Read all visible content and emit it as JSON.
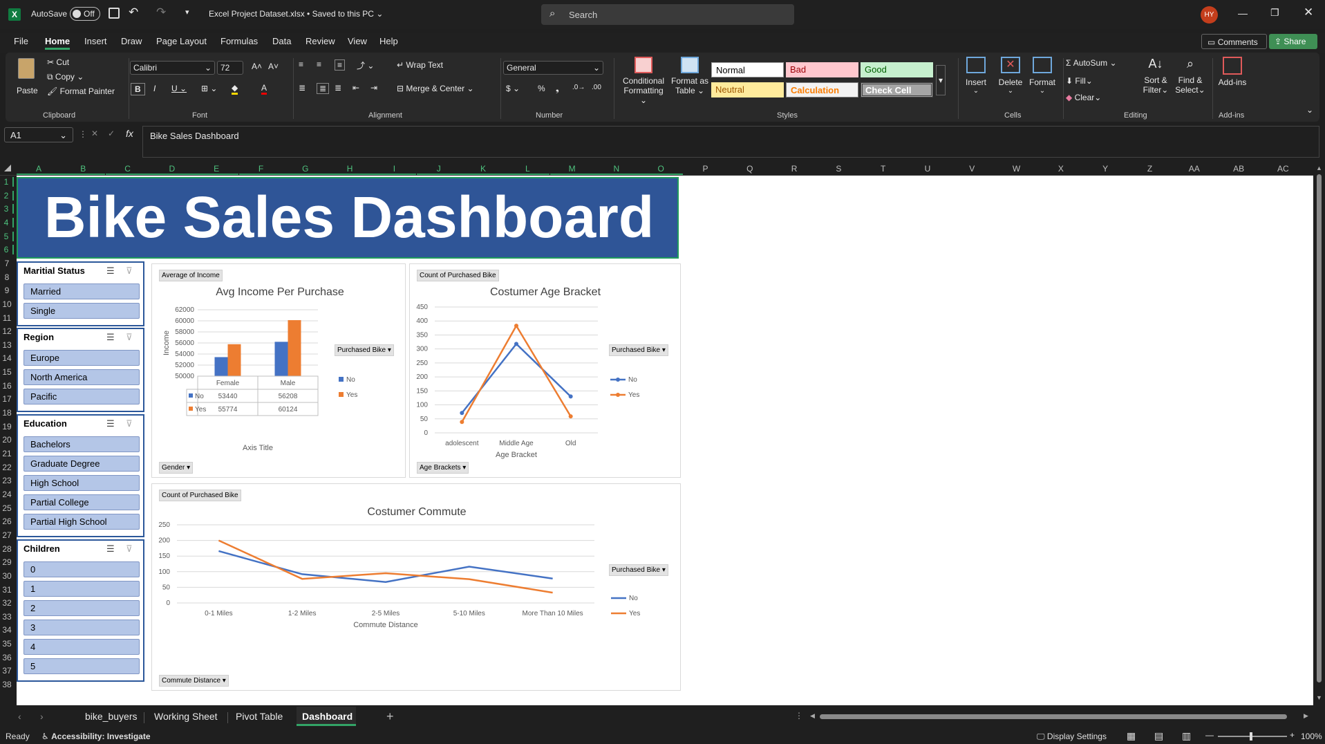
{
  "titlebar": {
    "autosave_label": "AutoSave",
    "autosave_state": "Off",
    "file_title": "Excel Project Dataset.xlsx",
    "saved_status": "Saved to this PC",
    "search_placeholder": "Search",
    "user_initials": "HY"
  },
  "menu": {
    "tabs": [
      "File",
      "Home",
      "Insert",
      "Draw",
      "Page Layout",
      "Formulas",
      "Data",
      "Review",
      "View",
      "Help"
    ],
    "comments": "Comments",
    "share": "Share"
  },
  "ribbon": {
    "paste": "Paste",
    "cut": "Cut",
    "copy": "Copy",
    "format_painter": "Format Painter",
    "clipboard": "Clipboard",
    "font_name": "Calibri",
    "font_size": "72",
    "font": "Font",
    "wrap_text": "Wrap Text",
    "merge_center": "Merge & Center",
    "alignment": "Alignment",
    "number_format": "General",
    "number": "Number",
    "conditional_formatting": "Conditional\nFormatting",
    "cf1": "Conditional",
    "cf2": "Formatting",
    "fat1": "Format as",
    "fat2": "Table",
    "styles_label": "Styles",
    "styles": [
      "Normal",
      "Bad",
      "Good",
      "Neutral",
      "Calculation",
      "Check Cell"
    ],
    "insert": "Insert",
    "delete": "Delete",
    "format": "Format",
    "cells": "Cells",
    "autosum": "AutoSum",
    "fill": "Fill",
    "clear": "Clear",
    "sort1": "Sort &",
    "sort2": "Filter",
    "find1": "Find &",
    "find2": "Select",
    "editing": "Editing",
    "addins": "Add-ins",
    "addins_group": "Add-ins"
  },
  "formula_bar": {
    "name_box": "A1",
    "formula": "Bike Sales Dashboard"
  },
  "columns": [
    "A",
    "B",
    "C",
    "D",
    "E",
    "F",
    "G",
    "H",
    "I",
    "J",
    "K",
    "L",
    "M",
    "N",
    "O",
    "P",
    "Q",
    "R",
    "S",
    "T",
    "U",
    "V",
    "W",
    "X",
    "Y",
    "Z",
    "AA",
    "AB",
    "AC"
  ],
  "rows": [
    "1",
    "2",
    "3",
    "4",
    "5",
    "6",
    "7",
    "8",
    "9",
    "10",
    "11",
    "12",
    "13",
    "14",
    "15",
    "16",
    "17",
    "18",
    "19",
    "20",
    "21",
    "22",
    "23",
    "24",
    "25",
    "26",
    "27",
    "28",
    "29",
    "30",
    "31",
    "32",
    "33",
    "34",
    "35",
    "36",
    "37",
    "38"
  ],
  "dashboard": {
    "title": "Bike Sales Dashboard",
    "slicers": {
      "marital": {
        "title": "Maritial Status",
        "items": [
          "Married",
          "Single"
        ]
      },
      "region": {
        "title": "Region",
        "items": [
          "Europe",
          "North America",
          "Pacific"
        ]
      },
      "education": {
        "title": "Education",
        "items": [
          "Bachelors",
          "Graduate Degree",
          "High School",
          "Partial College",
          "Partial High School"
        ]
      },
      "children": {
        "title": "Children",
        "items": [
          "0",
          "1",
          "2",
          "3",
          "4",
          "5"
        ]
      }
    }
  },
  "chart_data": [
    {
      "type": "bar",
      "title": "Avg Income Per Purchase",
      "value_field": "Average of Income",
      "axis_field": "Gender",
      "legend_title": "Purchased Bike",
      "xlabel": "Axis Title",
      "ylabel": "Income",
      "categories": [
        "Female",
        "Male"
      ],
      "ylim": [
        50000,
        62000
      ],
      "yticks": [
        "62000",
        "60000",
        "58000",
        "56000",
        "54000",
        "52000",
        "50000"
      ],
      "series": [
        {
          "name": "No",
          "values": [
            53440,
            56208
          ],
          "labels": [
            "53440",
            "56208"
          ],
          "color": "#4472c4"
        },
        {
          "name": "Yes",
          "values": [
            55774,
            60124
          ],
          "labels": [
            "55774",
            "60124"
          ],
          "color": "#ed7d31"
        }
      ]
    },
    {
      "type": "line",
      "title": "Costumer Age Bracket",
      "value_field": "Count of Purchased Bike",
      "axis_field": "Age Brackets",
      "legend_title": "Purchased Bike",
      "xlabel": "Age Bracket",
      "categories": [
        "adolescent",
        "Middle Age",
        "Old"
      ],
      "ylim": [
        0,
        450
      ],
      "yticks": [
        "450",
        "400",
        "350",
        "300",
        "250",
        "200",
        "150",
        "100",
        "50",
        "0"
      ],
      "series": [
        {
          "name": "No",
          "values": [
            71,
            318,
            130
          ],
          "color": "#4472c4"
        },
        {
          "name": "Yes",
          "values": [
            39,
            383,
            59
          ],
          "color": "#ed7d31"
        }
      ]
    },
    {
      "type": "line",
      "title": "Costumer Commute",
      "value_field": "Count of Purchased Bike",
      "axis_field": "Commute Distance",
      "legend_title": "Purchased Bike",
      "xlabel": "Commute Distance",
      "categories": [
        "0-1 Miles",
        "1-2 Miles",
        "2-5 Miles",
        "5-10 Miles",
        "More Than 10 Miles"
      ],
      "ylim": [
        0,
        250
      ],
      "yticks": [
        "250",
        "200",
        "150",
        "100",
        "50",
        "0"
      ],
      "series": [
        {
          "name": "No",
          "values": [
            166,
            92,
            67,
            116,
            78
          ],
          "color": "#4472c4"
        },
        {
          "name": "Yes",
          "values": [
            200,
            77,
            95,
            76,
            33
          ],
          "color": "#ed7d31"
        }
      ]
    }
  ],
  "sheet_tabs": [
    "bike_buyers",
    "Working Sheet",
    "Pivot Table",
    "Dashboard"
  ],
  "active_sheet": "Dashboard",
  "status": {
    "ready": "Ready",
    "accessibility": "Accessibility: Investigate",
    "display_settings": "Display Settings",
    "zoom": "100%"
  },
  "colors": {
    "excel_green": "#107c41",
    "title_fill": "#2f5597",
    "slicer_item": "#b4c6e7"
  }
}
